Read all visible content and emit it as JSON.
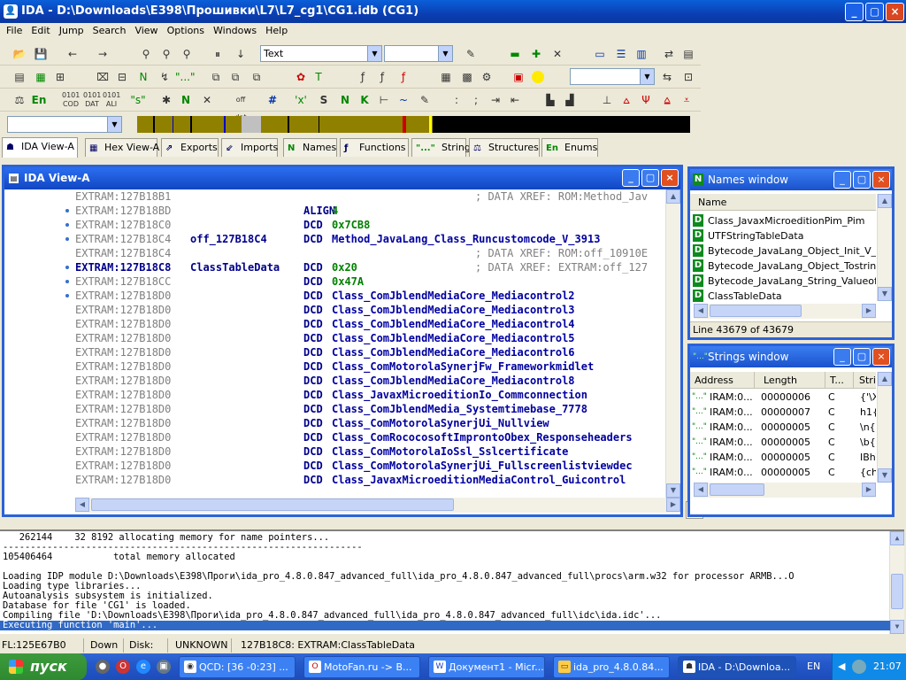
{
  "window": {
    "title": "IDA - D:\\Downloads\\E398\\Прошивки\\L7\\L7_cg1\\CG1.idb (CG1)",
    "icon": "ida-icon",
    "min": "_",
    "max": "▢",
    "close": "×"
  },
  "menu": [
    "File",
    "Edit",
    "Jump",
    "Search",
    "View",
    "Options",
    "Windows",
    "Help"
  ],
  "toolbar": {
    "text_combo": "Text",
    "empty_combo": "",
    "arrow": "▼"
  },
  "tabs": [
    {
      "icon": "ida-icon",
      "label": "IDA View-A"
    },
    {
      "icon": "hex-icon",
      "label": "Hex View-A"
    },
    {
      "icon": "exports-icon",
      "label": "Exports"
    },
    {
      "icon": "imports-icon",
      "label": "Imports"
    },
    {
      "icon": "N",
      "label": "Names"
    },
    {
      "icon": "functions-icon",
      "label": "Functions"
    },
    {
      "icon": "\"...\"",
      "label": "Strings"
    },
    {
      "icon": "structures-icon",
      "label": "Structures"
    },
    {
      "icon": "En",
      "label": "Enums"
    }
  ],
  "ida_view": {
    "title": "IDA View-A",
    "lines": [
      {
        "addr": "EXTRAM:127B18B1",
        "cmt": "; DATA XREF: ROM:Method_Jav",
        "dot": false
      },
      {
        "addr": "EXTRAM:127B18BD",
        "mn": "ALIGN",
        "op": "4",
        "num": true,
        "dot": true
      },
      {
        "addr": "EXTRAM:127B18C0",
        "mn": "DCD",
        "op": "0x7CB8",
        "num": true,
        "dot": true
      },
      {
        "addr": "EXTRAM:127B18C4",
        "lbl": "off_127B18C4",
        "mn": "DCD",
        "op": "Method_JavaLang_Class_Runcustomcode_V_3913",
        "dot": true
      },
      {
        "addr": "EXTRAM:127B18C4",
        "cmt": "; DATA XREF: ROM:off_10910E",
        "dot": false
      },
      {
        "addr": "EXTRAM:127B18C8",
        "lbl": "ClassTableData",
        "mn": "DCD",
        "op": "0x20",
        "num": true,
        "cmt": "; DATA XREF: EXTRAM:off_127",
        "cur": true,
        "dot": true
      },
      {
        "addr": "EXTRAM:127B18CC",
        "mn": "DCD",
        "op": "0x47A",
        "num": true,
        "dot": true
      },
      {
        "addr": "EXTRAM:127B18D0",
        "mn": "DCD",
        "op": "Class_ComJblendMediaCore_Mediacontrol2",
        "dot": true
      },
      {
        "addr": "EXTRAM:127B18D0",
        "mn": "DCD",
        "op": "Class_ComJblendMediaCore_Mediacontrol3",
        "dot": false
      },
      {
        "addr": "EXTRAM:127B18D0",
        "mn": "DCD",
        "op": "Class_ComJblendMediaCore_Mediacontrol4",
        "dot": false
      },
      {
        "addr": "EXTRAM:127B18D0",
        "mn": "DCD",
        "op": "Class_ComJblendMediaCore_Mediacontrol5",
        "dot": false
      },
      {
        "addr": "EXTRAM:127B18D0",
        "mn": "DCD",
        "op": "Class_ComJblendMediaCore_Mediacontrol6",
        "dot": false
      },
      {
        "addr": "EXTRAM:127B18D0",
        "mn": "DCD",
        "op": "Class_ComMotorolaSynerjFw_Frameworkmidlet",
        "dot": false
      },
      {
        "addr": "EXTRAM:127B18D0",
        "mn": "DCD",
        "op": "Class_ComJblendMediaCore_Mediacontrol8",
        "dot": false
      },
      {
        "addr": "EXTRAM:127B18D0",
        "mn": "DCD",
        "op": "Class_JavaxMicroeditionIo_Commconnection",
        "dot": false
      },
      {
        "addr": "EXTRAM:127B18D0",
        "mn": "DCD",
        "op": "Class_ComJblendMedia_Systemtimebase_7778",
        "dot": false
      },
      {
        "addr": "EXTRAM:127B18D0",
        "mn": "DCD",
        "op": "Class_ComMotorolaSynerjUi_Nullview",
        "dot": false
      },
      {
        "addr": "EXTRAM:127B18D0",
        "mn": "DCD",
        "op": "Class_ComRococosoftImprontoObex_Responseheaders",
        "dot": false
      },
      {
        "addr": "EXTRAM:127B18D0",
        "mn": "DCD",
        "op": "Class_ComMotorolaIoSsl_Sslcertificate",
        "dot": false
      },
      {
        "addr": "EXTRAM:127B18D0",
        "mn": "DCD",
        "op": "Class_ComMotorolaSynerjUi_Fullscreenlistviewdec",
        "dot": false
      },
      {
        "addr": "EXTRAM:127B18D0",
        "mn": "DCD",
        "op": "Class_JavaxMicroeditionMediaControl_Guicontrol",
        "dot": false
      }
    ]
  },
  "names_window": {
    "title": "Names window",
    "header": "Name",
    "rows": [
      "Class_JavaxMicroeditionPim_Pim",
      "UTFStringTableData",
      "Bytecode_JavaLang_Object_Init_V_39",
      "Bytecode_JavaLang_Object_Tostring_",
      "Bytecode_JavaLang_String_Valueof_",
      "ClassTableData"
    ],
    "status": "Line 43679 of 43679"
  },
  "strings_window": {
    "title": "Strings window",
    "headers": [
      "Address",
      "Length",
      "T...",
      "Stri"
    ],
    "rows": [
      [
        "IRAM:0...",
        "00000006",
        "C",
        "{'\\X"
      ],
      [
        "IRAM:0...",
        "00000007",
        "C",
        "h1{I"
      ],
      [
        "IRAM:0...",
        "00000005",
        "C",
        "\\n{"
      ],
      [
        "IRAM:0...",
        "00000005",
        "C",
        "\\b{"
      ],
      [
        "IRAM:0...",
        "00000005",
        "C",
        "IBh\\"
      ],
      [
        "IRAM:0...",
        "00000005",
        "C",
        "{ch\\"
      ]
    ]
  },
  "log": [
    {
      "text": "   262144    32 8192 allocating memory for name pointers..."
    },
    {
      "text": "-----------------------------------------------------------------"
    },
    {
      "text": "105406464           total memory allocated"
    },
    {
      "text": ""
    },
    {
      "text": "Loading IDP module D:\\Downloads\\E398\\Проги\\ida_pro_4.8.0.847_advanced_full\\ida_pro_4.8.0.847_advanced_full\\procs\\arm.w32 for processor ARMB...O"
    },
    {
      "text": "Loading type libraries..."
    },
    {
      "text": "Autoanalysis subsystem is initialized."
    },
    {
      "text": "Database for file 'CG1' is loaded."
    },
    {
      "text": "Compiling file 'D:\\Downloads\\E398\\Проги\\ida_pro_4.8.0.847_advanced_full\\ida_pro_4.8.0.847_advanced_full\\idc\\ida.idc'..."
    },
    {
      "text": "Executing function 'main'...",
      "sel": true
    }
  ],
  "status": [
    "FL:125E67B0",
    "Down",
    "Disk: 253MB",
    "UNKNOWN",
    "127B18C8: EXTRAM:ClassTableData"
  ],
  "taskbar": {
    "start": "пуск",
    "tasks": [
      {
        "label": "QCD: [36 -0:23] ...",
        "active": false
      },
      {
        "label": "MotoFan.ru -> В...",
        "active": false
      },
      {
        "label": "Документ1 - Micr...",
        "active": false
      },
      {
        "label": "ida_pro_4.8.0.84...",
        "active": false
      },
      {
        "label": "IDA - D:\\Downloa...",
        "active": true
      }
    ],
    "lang": "EN",
    "clock": "21:07"
  }
}
